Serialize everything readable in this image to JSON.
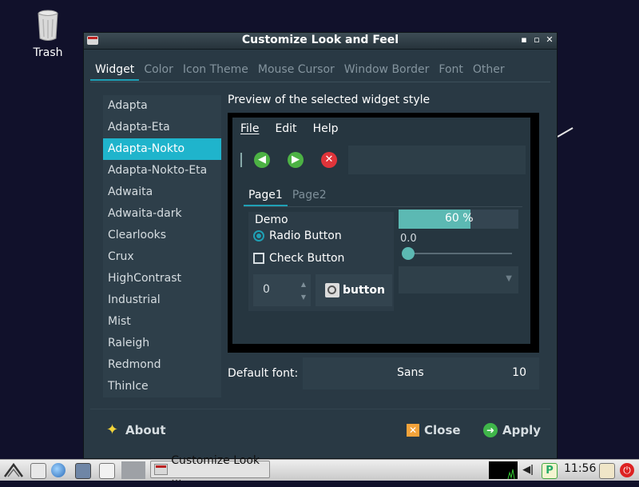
{
  "desktop": {
    "trash_label": "Trash"
  },
  "window": {
    "title": "Customize Look and Feel",
    "controls": {
      "minimize": "▪",
      "maximize": "▫",
      "close": "✕"
    }
  },
  "tabs": [
    {
      "label": "Widget",
      "active": true
    },
    {
      "label": "Color"
    },
    {
      "label": "Icon Theme"
    },
    {
      "label": "Mouse Cursor"
    },
    {
      "label": "Window Border"
    },
    {
      "label": "Font"
    },
    {
      "label": "Other"
    }
  ],
  "themes": [
    "Adapta",
    "Adapta-Eta",
    "Adapta-Nokto",
    "Adapta-Nokto-Eta",
    "Adwaita",
    "Adwaita-dark",
    "Clearlooks",
    "Crux",
    "HighContrast",
    "Industrial",
    "Mist",
    "Raleigh",
    "Redmond",
    "ThinIce"
  ],
  "selected_theme": "Adapta-Nokto",
  "preview": {
    "label": "Preview of the selected widget style",
    "menu": [
      "File",
      "Edit",
      "Help"
    ],
    "tabs": [
      "Page1",
      "Page2"
    ],
    "demo_title": "Demo",
    "radio_label": "Radio Button",
    "check_label": "Check Button",
    "spin_value": "0",
    "button_label": "button",
    "progress_text": "60 %",
    "progress_value": 0.6,
    "scale_value": "0.0",
    "toolbar_icons": [
      "back-icon",
      "forward-icon",
      "stop-icon"
    ]
  },
  "font": {
    "label": "Default font:",
    "name": "Sans",
    "size": "10"
  },
  "actions": {
    "about": "About",
    "close": "Close",
    "apply": "Apply"
  },
  "taskbar": {
    "task_label": "Customize Look ...",
    "clock": "11:56"
  },
  "colors": {
    "accent": "#1fb4cc",
    "window_bg": "#293944",
    "desktop_bg": "#11112b"
  }
}
